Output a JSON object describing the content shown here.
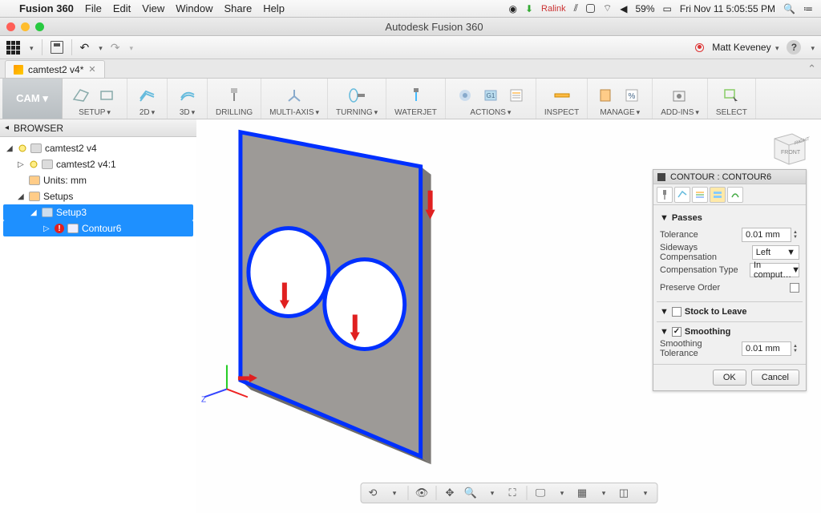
{
  "macmenu": {
    "app": "Fusion 360",
    "items": [
      "File",
      "Edit",
      "View",
      "Window",
      "Share",
      "Help"
    ],
    "battery": "59%",
    "clock": "Fri Nov 11  5:05:55 PM",
    "ralink": "Ralink"
  },
  "window": {
    "title": "Autodesk Fusion 360"
  },
  "qat": {
    "user": "Matt Keveney"
  },
  "doctab": {
    "name": "camtest2 v4*"
  },
  "ribbon": {
    "mode": "CAM ▾",
    "groups": [
      {
        "label": "SETUP",
        "caret": true
      },
      {
        "label": "2D",
        "caret": true
      },
      {
        "label": "3D",
        "caret": true
      },
      {
        "label": "DRILLING",
        "caret": false
      },
      {
        "label": "MULTI-AXIS",
        "caret": true
      },
      {
        "label": "TURNING",
        "caret": true
      },
      {
        "label": "WATERJET",
        "caret": false
      },
      {
        "label": "ACTIONS",
        "caret": true
      },
      {
        "label": "INSPECT",
        "caret": false
      },
      {
        "label": "MANAGE",
        "caret": true
      },
      {
        "label": "ADD-INS",
        "caret": true
      },
      {
        "label": "SELECT",
        "caret": false
      }
    ]
  },
  "browser": {
    "title": "BROWSER",
    "root": "camtest2 v4",
    "items": {
      "child1": "camtest2 v4:1",
      "units": "Units: mm",
      "setups": "Setups",
      "setup3": "Setup3",
      "contour6": "Contour6"
    }
  },
  "panel": {
    "title": "CONTOUR : CONTOUR6",
    "passes": "Passes",
    "tolerance_label": "Tolerance",
    "tolerance_value": "0.01 mm",
    "sideways_label": "Sideways Compensation",
    "sideways_value": "Left",
    "comp_label": "Compensation Type",
    "comp_value": "In comput…",
    "preserve_label": "Preserve Order",
    "stock_label": "Stock to Leave",
    "smoothing_label": "Smoothing",
    "smooth_tol_label": "Smoothing Tolerance",
    "smooth_tol_value": "0.01 mm",
    "ok": "OK",
    "cancel": "Cancel"
  },
  "viewcube": {
    "front": "FRONT",
    "right": "RIGHT"
  }
}
